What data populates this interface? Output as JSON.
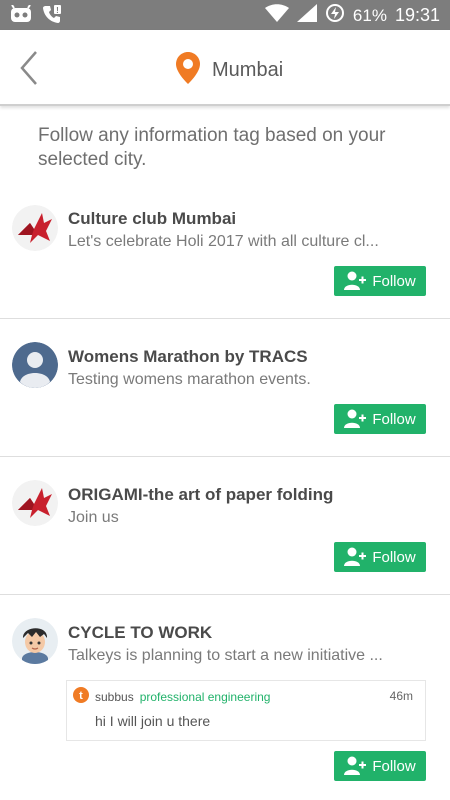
{
  "status_bar": {
    "battery": "61%",
    "time": "19:31"
  },
  "header": {
    "city": "Mumbai"
  },
  "intro": "Follow any information tag based on your selected city.",
  "tags": [
    {
      "title": "Culture club Mumbai",
      "description": "Let's celebrate Holi 2017 with all culture cl...",
      "follow_label": "Follow"
    },
    {
      "title": "Womens Marathon by TRACS",
      "description": "Testing womens marathon events.",
      "follow_label": "Follow"
    },
    {
      "title": "ORIGAMI-the art of paper folding",
      "description": "Join us",
      "follow_label": "Follow"
    },
    {
      "title": "CYCLE TO WORK",
      "description": "Talkeys is planning to start a new initiative ...",
      "follow_label": "Follow"
    }
  ],
  "comment": {
    "user": "subbus",
    "role": "professional engineering",
    "time": "46m",
    "text": "hi I will join u there"
  },
  "colors": {
    "accent_green": "#21b26a",
    "pin_orange": "#f07b24"
  }
}
